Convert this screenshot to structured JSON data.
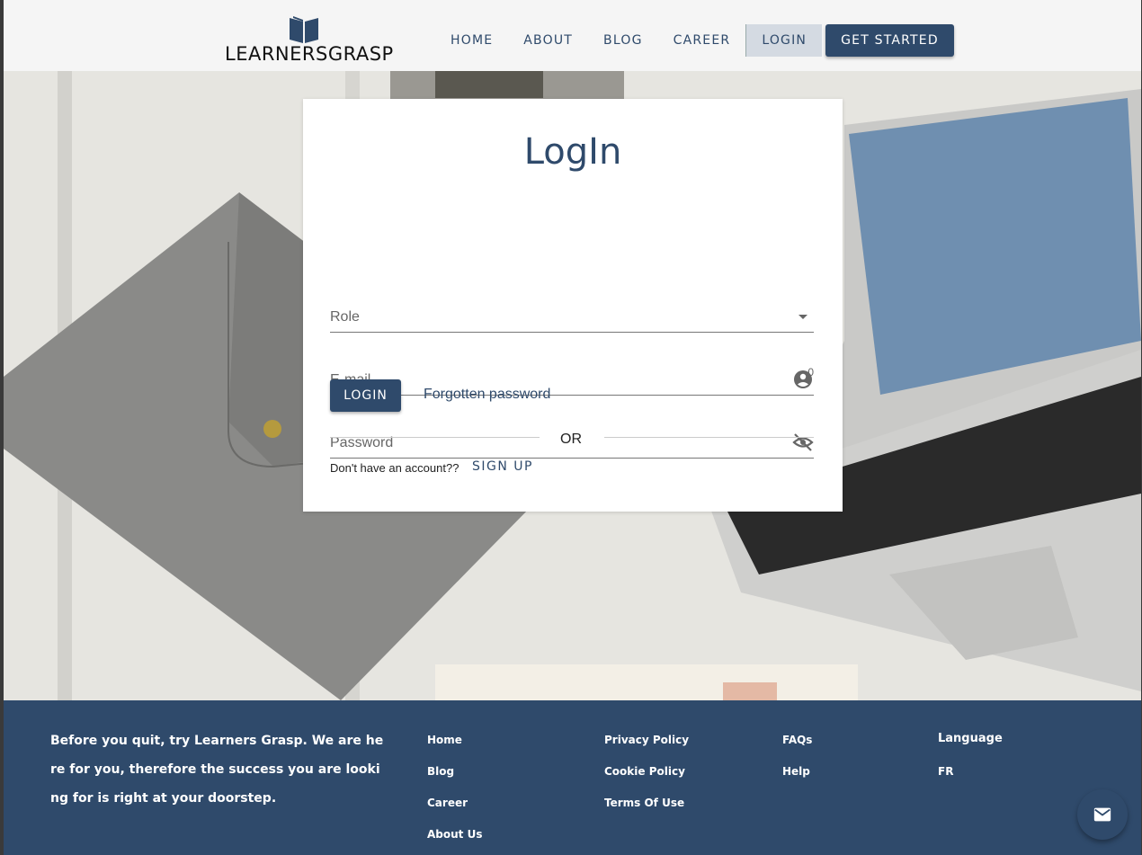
{
  "brand": {
    "name": "LEARNERSGRASP"
  },
  "nav": {
    "items": [
      "HOME",
      "ABOUT",
      "BLOG",
      "CAREER",
      "LOGIN"
    ],
    "cta": "GET STARTED",
    "active": "LOGIN"
  },
  "login": {
    "title": "LogIn",
    "role_label": "Role",
    "email_label": "E-mail",
    "password_label": "Password",
    "password_counter": "0",
    "login_button": "LOGIN",
    "forgot_link": "Forgotten password",
    "or_text": "OR",
    "no_account_text": "Don't have an account??",
    "signup_button": "SIGN UP"
  },
  "footer": {
    "tagline": "Before you quit, try Learners Grasp. We are here for you, therefore the success you are looking for is right at your doorstep.",
    "col1": [
      "Home",
      "Blog",
      "Career",
      "About Us"
    ],
    "col2": [
      "Privacy Policy",
      "Cookie Policy",
      "Terms Of Use"
    ],
    "col3": [
      "FAQs",
      "Help"
    ],
    "language_title": "Language",
    "language_value": "FR"
  },
  "colors": {
    "primary": "#2f4a6b",
    "footer_bg": "#2f4a6b",
    "header_bg": "#f5f5f5"
  },
  "icons": {
    "logo": "book-icon",
    "role": "dropdown-arrow-icon",
    "email": "account-circle-icon",
    "password": "visibility-off-icon",
    "fab": "mail-icon"
  }
}
